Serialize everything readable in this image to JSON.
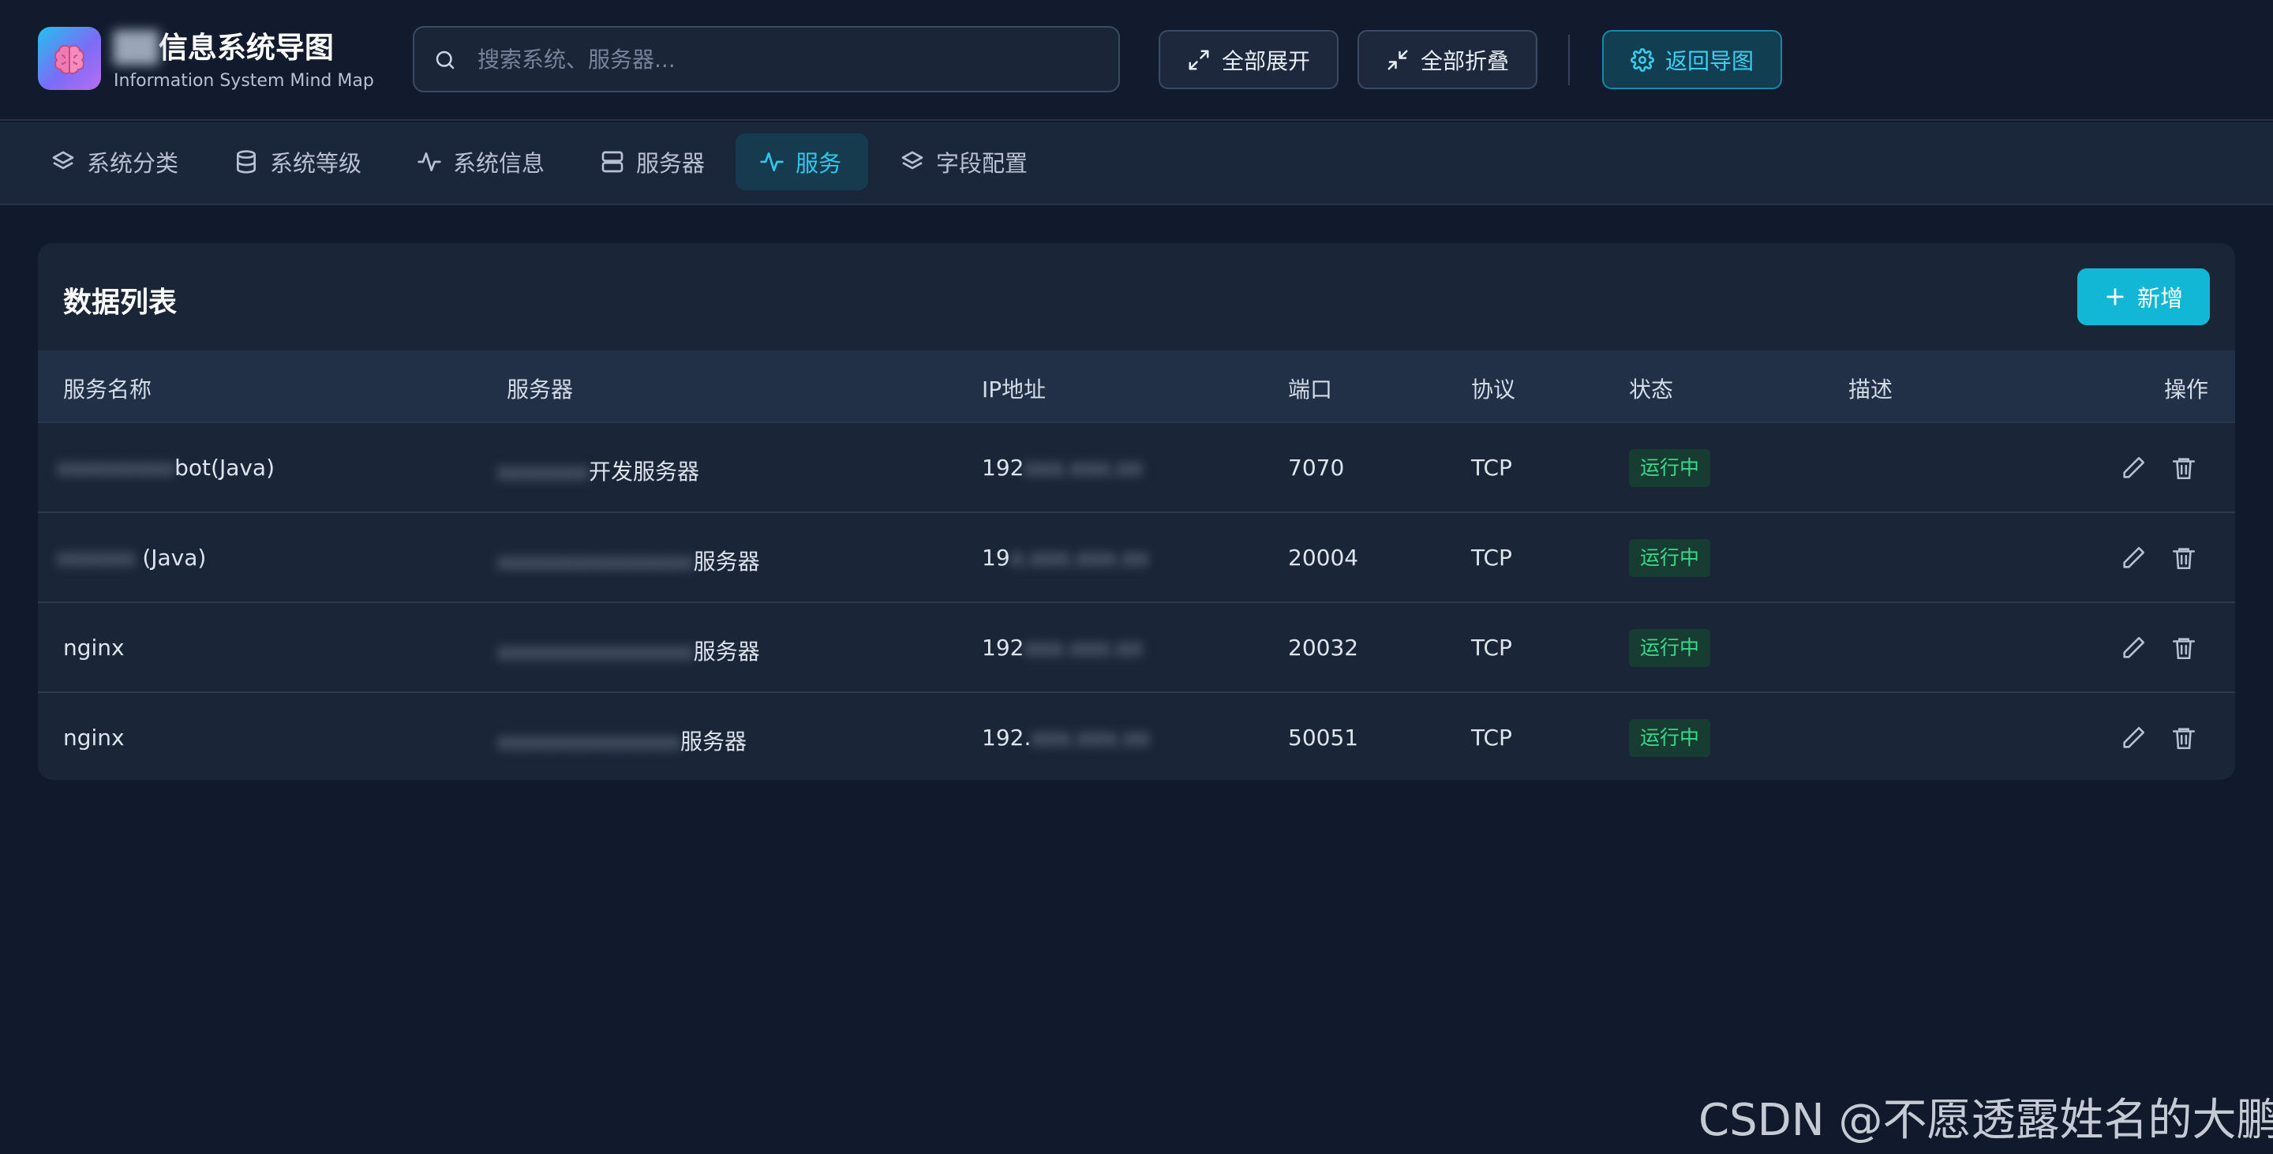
{
  "header": {
    "title_blurred": "██",
    "title": "信息系统导图",
    "subtitle": "Information System Mind Map",
    "search_placeholder": "搜索系统、服务器...",
    "expand_all": "全部展开",
    "collapse_all": "全部折叠",
    "back_to_map": "返回导图",
    "logo_icon": "brain-icon"
  },
  "nav": {
    "tabs": [
      {
        "label": "系统分类",
        "icon": "layers-icon",
        "active": false
      },
      {
        "label": "系统等级",
        "icon": "database-icon",
        "active": false
      },
      {
        "label": "系统信息",
        "icon": "activity-icon",
        "active": false
      },
      {
        "label": "服务器",
        "icon": "server-icon",
        "active": false
      },
      {
        "label": "服务",
        "icon": "activity-icon",
        "active": true
      },
      {
        "label": "字段配置",
        "icon": "layers-icon",
        "active": false
      }
    ]
  },
  "table": {
    "title": "数据列表",
    "add_label": "新增",
    "columns": [
      "服务名称",
      "服务器",
      "IP地址",
      "端口",
      "协议",
      "状态",
      "描述",
      "操作"
    ],
    "rows": [
      {
        "name_blur": "xxxxxxxxx",
        "name": "bot(Java)",
        "server_blur": "xxxxxxx",
        "server": "开发服务器",
        "ip_prefix": "192",
        "ip_blur": "xxx.xxx.xx",
        "port": "7070",
        "protocol": "TCP",
        "status": "运行中",
        "desc": ""
      },
      {
        "name_blur": "xxxxxx",
        "name": "(Java)",
        "server_blur": "xxxxxxxxxxxxxxx",
        "server": "服务器",
        "ip_prefix": "19",
        "ip_blur": "x.xxx.xxx.xx",
        "port": "20004",
        "protocol": "TCP",
        "status": "运行中",
        "desc": ""
      },
      {
        "name_blur": "",
        "name": "nginx",
        "server_blur": "xxxxxxxxxxxxxxx",
        "server": "服务器",
        "ip_prefix": "192",
        "ip_blur": "xxx.xxx.xx",
        "port": "20032",
        "protocol": "TCP",
        "status": "运行中",
        "desc": ""
      },
      {
        "name_blur": "",
        "name": "nginx",
        "server_blur": "xxxxxxxxxxxxxx",
        "server": "服务器",
        "ip_prefix": "192.",
        "ip_blur": "xxx.xxx.xx",
        "port": "50051",
        "protocol": "TCP",
        "status": "运行中",
        "desc": ""
      }
    ]
  },
  "colors": {
    "background": "#111a2c",
    "accent": "#13b7d6",
    "active_tab_text": "#2fc7ec",
    "status_green": "#38d98a"
  },
  "watermark": "CSDN @不愿透露姓名的大鹏"
}
